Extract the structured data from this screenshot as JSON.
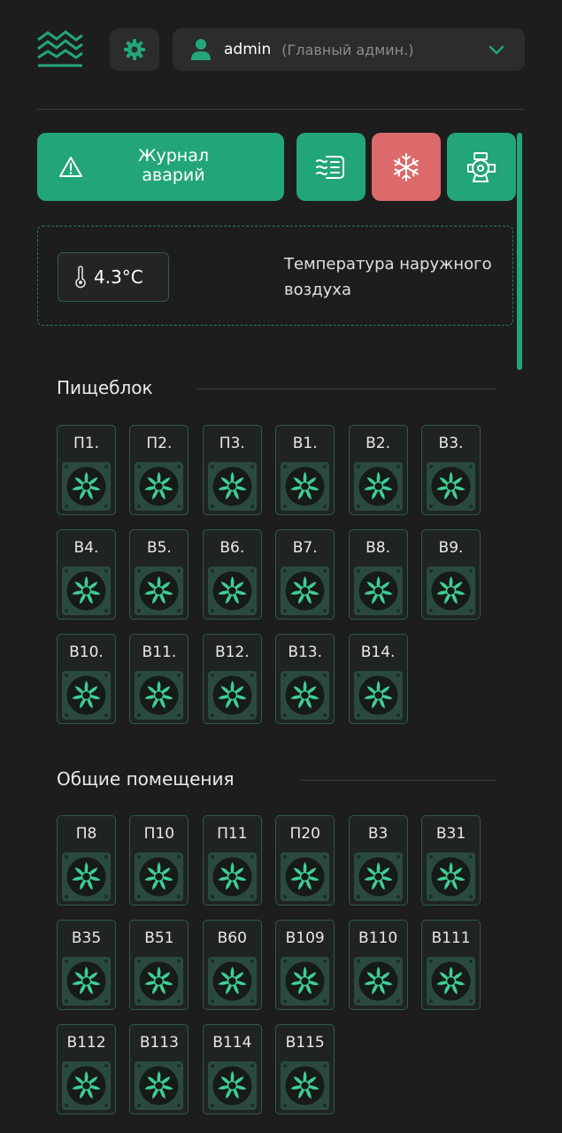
{
  "header": {
    "user_name": "admin",
    "user_role": "(Главный админ.)",
    "icons": [
      "logo-mountains-icon",
      "gear-icon",
      "user-icon",
      "chevron-down-icon"
    ]
  },
  "toolbar": {
    "alarm_log_label": "Журнал аварий",
    "buttons": [
      "ventilation-icon",
      "snowflake-icon",
      "pump-icon"
    ],
    "colors": {
      "green": "#23a57a",
      "red": "#dc6a6a"
    }
  },
  "outdoor": {
    "temperature": "4.3°C",
    "label": "Температура наружного воздуха"
  },
  "sections": [
    {
      "title": "Пищеблок",
      "units": [
        "П1.",
        "П2.",
        "П3.",
        "В1.",
        "В2.",
        "В3.",
        "В4.",
        "В5.",
        "В6.",
        "В7.",
        "В8.",
        "В9.",
        "В10.",
        "В11.",
        "В12.",
        "В13.",
        "В14."
      ]
    },
    {
      "title": "Общие помещения",
      "units": [
        "П8",
        "П10",
        "П11",
        "П20",
        "В3",
        "В31",
        "В35",
        "В51",
        "В60",
        "В109",
        "В110",
        "В111",
        "В112",
        "В113",
        "В114",
        "В115"
      ]
    }
  ]
}
